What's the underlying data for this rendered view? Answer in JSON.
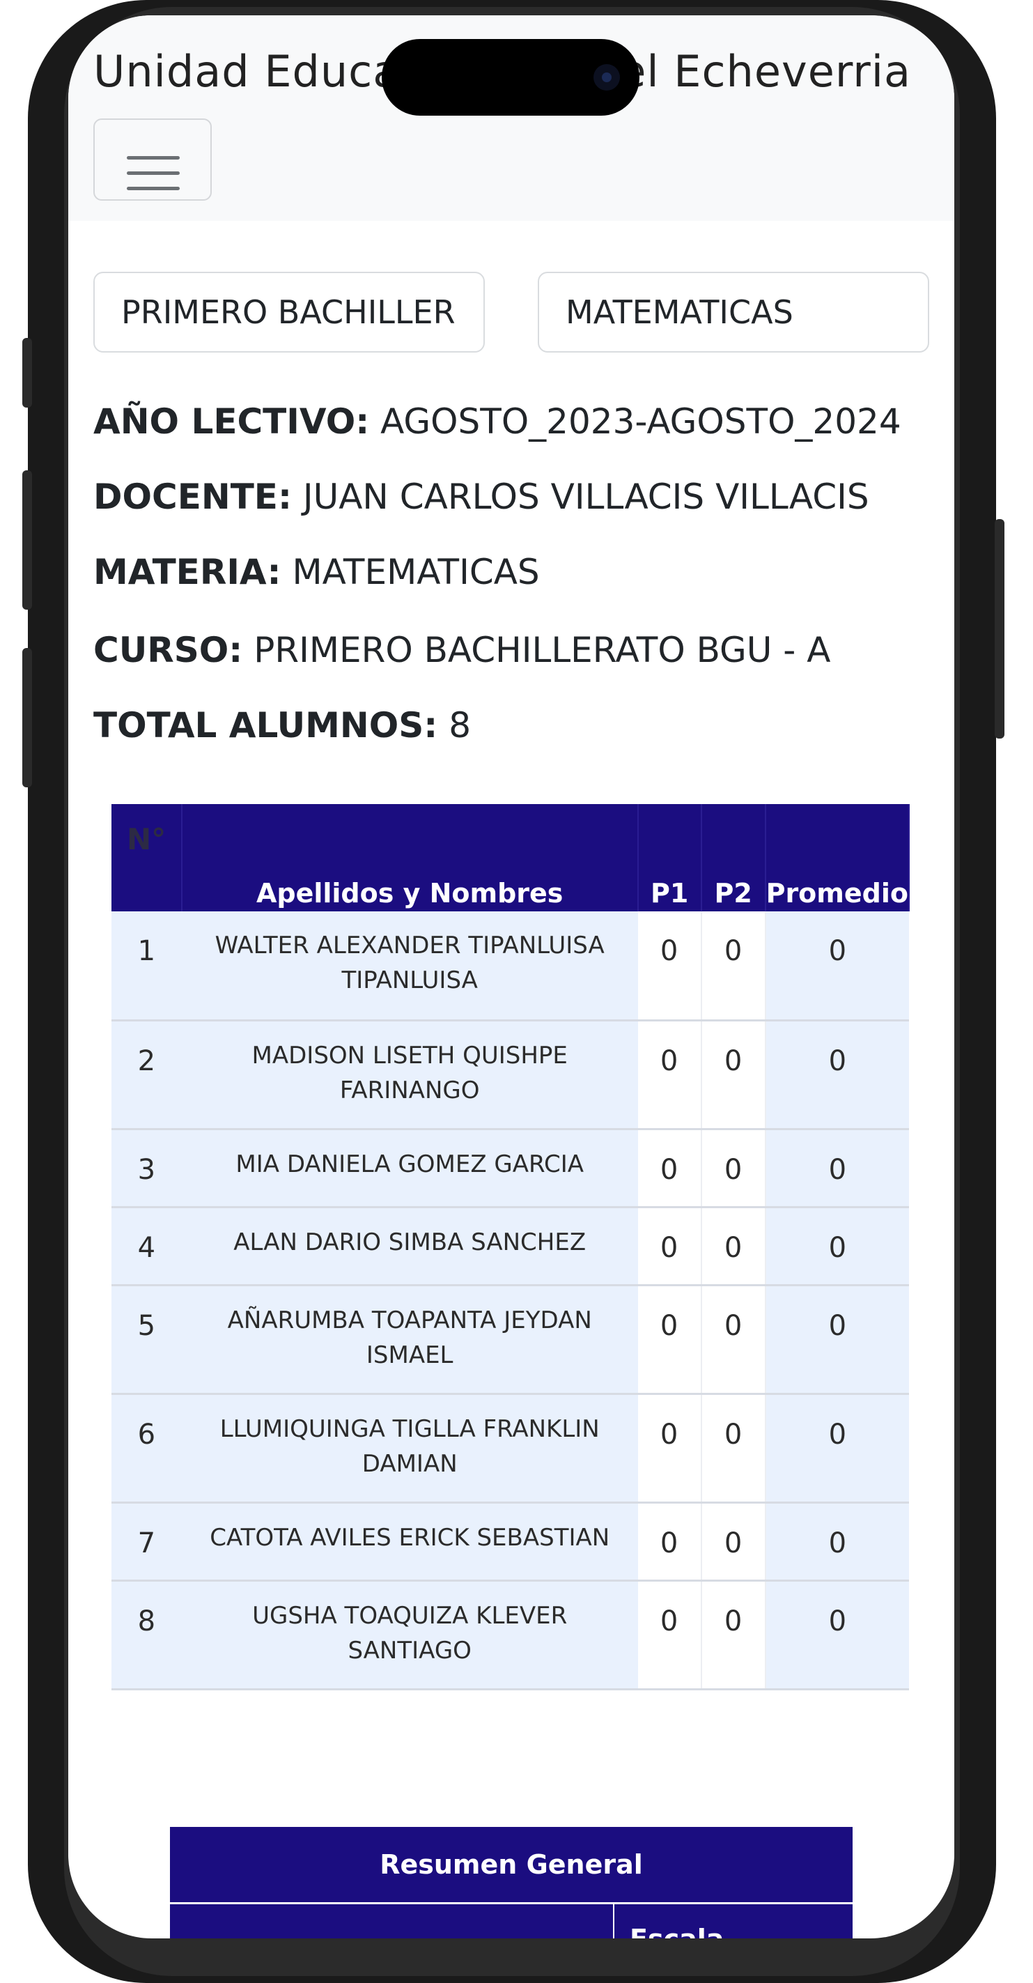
{
  "header": {
    "school_title": "Unidad Educativa Manuel Echeverria",
    "menu_label": "menu"
  },
  "filters": {
    "curso_select": "PRIMERO BACHILLER",
    "materia_select": "MATEMATICAS"
  },
  "info": {
    "anio_label": "AÑO LECTIVO:",
    "anio_value": "AGOSTO_2023-AGOSTO_2024",
    "docente_label": "DOCENTE:",
    "docente_value": "JUAN CARLOS VILLACIS VILLACIS",
    "materia_label": "MATERIA:",
    "materia_value": "MATEMATICAS",
    "curso_label": "CURSO:",
    "curso_value": "PRIMERO BACHILLERATO BGU - A",
    "total_label": "TOTAL ALUMNOS:",
    "total_value": "8"
  },
  "table": {
    "headers": [
      "N°",
      "Apellidos y Nombres",
      "P1",
      "P2",
      "Promedio"
    ],
    "rows": [
      {
        "n": "1",
        "name": "WALTER ALEXANDER TIPANLUISA TIPANLUISA",
        "p1": "0",
        "p2": "0",
        "avg": "0"
      },
      {
        "n": "2",
        "name": "MADISON LISETH QUISHPE FARINANGO",
        "p1": "0",
        "p2": "0",
        "avg": "0"
      },
      {
        "n": "3",
        "name": "MIA DANIELA GOMEZ GARCIA",
        "p1": "0",
        "p2": "0",
        "avg": "0"
      },
      {
        "n": "4",
        "name": "ALAN DARIO SIMBA SANCHEZ",
        "p1": "0",
        "p2": "0",
        "avg": "0"
      },
      {
        "n": "5",
        "name": "AÑARUMBA TOAPANTA JEYDAN ISMAEL",
        "p1": "0",
        "p2": "0",
        "avg": "0"
      },
      {
        "n": "6",
        "name": "LLUMIQUINGA TIGLLA FRANKLIN DAMIAN",
        "p1": "0",
        "p2": "0",
        "avg": "0"
      },
      {
        "n": "7",
        "name": "CATOTA AVILES ERICK SEBASTIAN",
        "p1": "0",
        "p2": "0",
        "avg": "0"
      },
      {
        "n": "8",
        "name": "UGSHA TOAQUIZA KLEVER SANTIAGO",
        "p1": "0",
        "p2": "0",
        "avg": "0"
      }
    ]
  },
  "summary": {
    "title": "Resumen General",
    "scale_header": "Escala"
  },
  "colors": {
    "header_bg": "#1b0d80",
    "row_bg": "#e9f1fd",
    "topbar_bg": "#f8f9fa"
  },
  "icons": {
    "menu": "hamburger-icon"
  }
}
